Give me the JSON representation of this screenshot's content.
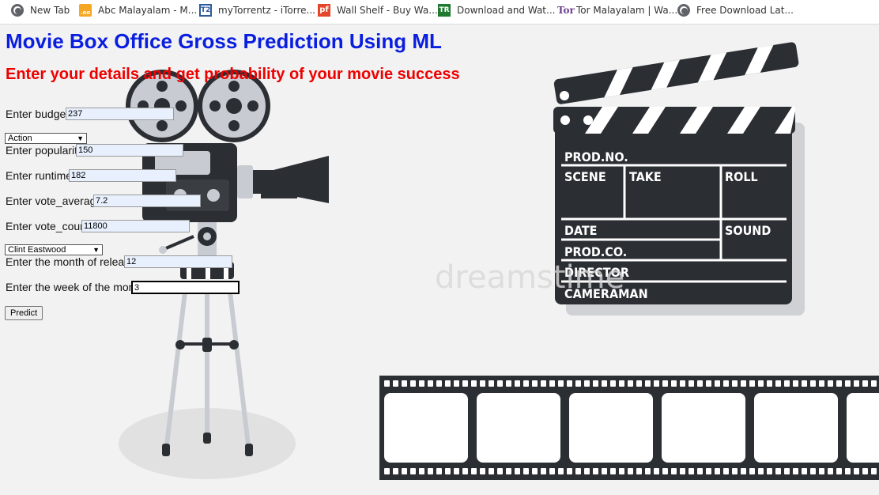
{
  "bookmarks": [
    {
      "label": "New Tab",
      "icon": "globe-icon"
    },
    {
      "label": "Abc Malayalam - M...",
      "icon": "abc-malayalam-icon"
    },
    {
      "label": "myTorrentz - iTorre...",
      "icon": "mytorrentz-icon"
    },
    {
      "label": "Wall Shelf - Buy Wa...",
      "icon": "pepperfry-icon"
    },
    {
      "label": "Download and Wat...",
      "icon": "tr-icon"
    },
    {
      "label": "Tor Malayalam | Wa...",
      "icon": "tor-icon"
    },
    {
      "label": "Free Download Lat...",
      "icon": "globe-icon"
    }
  ],
  "page": {
    "title": "Movie Box Office Gross Prediction Using ML",
    "subtitle": "Enter your details and get probability of your movie success",
    "watermark": "dreamstime"
  },
  "form": {
    "budget": {
      "label": "Enter budget",
      "value": "237"
    },
    "genre": {
      "selected": "Action"
    },
    "popularity": {
      "label": "Enter popularity",
      "value": "150"
    },
    "runtime": {
      "label": "Enter runtime",
      "value": "182"
    },
    "vote_average": {
      "label": "Enter vote_average",
      "value": "7.2"
    },
    "vote_count": {
      "label": "Enter vote_count",
      "value": "11800"
    },
    "director": {
      "selected": "Clint Eastwood"
    },
    "month": {
      "label": "Enter the month of release",
      "value": "12"
    },
    "week": {
      "label": "Enter the week of the month",
      "value": "3"
    },
    "predict_label": "Predict"
  },
  "clapperboard": {
    "prod_no": "PROD.NO.",
    "scene": "SCENE",
    "take": "TAKE",
    "roll": "ROLL",
    "date": "DATE",
    "sound": "SOUND",
    "prod_co": "PROD.CO.",
    "director": "DIRECTOR",
    "cameraman": "CAMERAMAN"
  },
  "colors": {
    "title": "#0a1ee0",
    "subtitle": "#ee0000",
    "dark": "#2b2e33",
    "input_bg": "#e8f0fe"
  }
}
